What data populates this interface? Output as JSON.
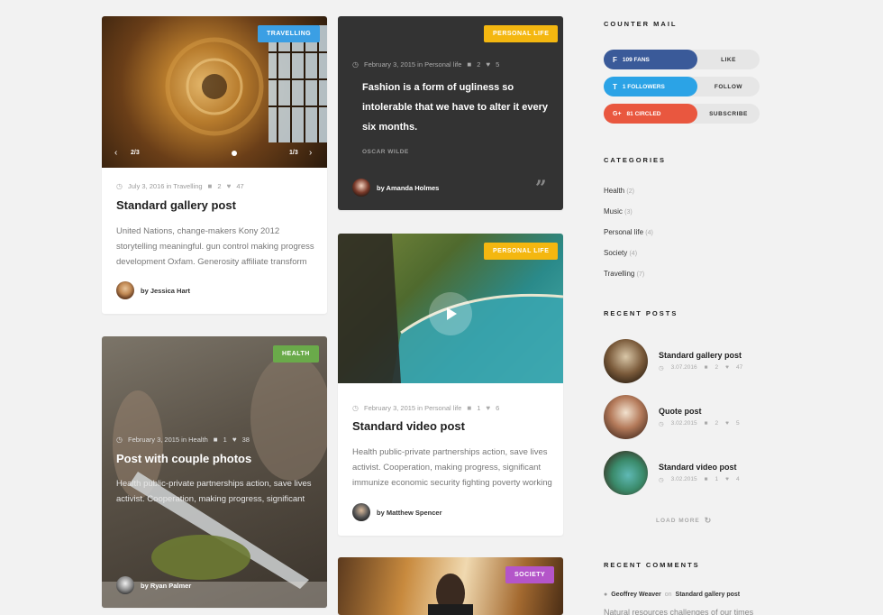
{
  "posts": {
    "gallery": {
      "badge": "TRAVELLING",
      "badge_color": "#3b9fe4",
      "slider_left": "2/3",
      "slider_right": "1/3",
      "date": "July 3, 2016 in Travelling",
      "comments": "2",
      "likes": "47",
      "title": "Standard gallery post",
      "excerpt": "United Nations, change-makers Kony 2012 storytelling meaningful. gun control making progress development Oxfam. Generosity affiliate transform",
      "author": "by Jessica Hart"
    },
    "quote": {
      "badge": "PERSONAL LIFE",
      "badge_color": "#f4b710",
      "date": "February 3, 2015 in Personal life",
      "comments": "2",
      "likes": "5",
      "quote": "Fashion is a form of ugliness so intolerable that we have to alter it every six months.",
      "quote_author": "OSCAR WILDE",
      "author": "by Amanda Holmes"
    },
    "photos": {
      "badge": "HEALTH",
      "badge_color": "#6aaa4a",
      "date": "February 3, 2015 in Health",
      "comments": "1",
      "likes": "38",
      "title": "Post with couple photos",
      "excerpt": "Health public-private partnerships action, save lives activist. Cooperation, making progress, significant",
      "author": "by Ryan Palmer"
    },
    "video": {
      "badge": "PERSONAL LIFE",
      "badge_color": "#f4b710",
      "date": "February 3, 2015 in Personal life",
      "comments": "1",
      "likes": "6",
      "title": "Standard video post",
      "excerpt": "Health public-private partnerships action, save lives activist. Cooperation, making progress, significant immunize economic security fighting poverty working",
      "author": "by Matthew Spencer"
    },
    "society": {
      "badge": "SOCIETY",
      "badge_color": "#b455c9"
    }
  },
  "sidebar": {
    "counter_title": "COUNTER MAIL",
    "social": [
      {
        "count": "109 FANS",
        "action": "LIKE",
        "color": "#3a5a99",
        "icon": "f"
      },
      {
        "count": "1 FOLLOWERS",
        "action": "FOLLOW",
        "color": "#2ba3e6",
        "icon": "t"
      },
      {
        "count": "81 CIRCLED",
        "action": "SUBSCRIBE",
        "color": "#e9573f",
        "icon": "G+"
      }
    ],
    "categories_title": "CATEGORIES",
    "categories": [
      {
        "name": "Health",
        "count": "(2)"
      },
      {
        "name": "Music",
        "count": "(3)"
      },
      {
        "name": "Personal life",
        "count": "(4)"
      },
      {
        "name": "Society",
        "count": "(4)"
      },
      {
        "name": "Travelling",
        "count": "(7)"
      }
    ],
    "recent_title": "RECENT POSTS",
    "recent": [
      {
        "title": "Standard gallery post",
        "date": "3.07.2016",
        "comments": "2",
        "likes": "47"
      },
      {
        "title": "Quote post",
        "date": "3.02.2015",
        "comments": "2",
        "likes": "5"
      },
      {
        "title": "Standard video post",
        "date": "3.02.2015",
        "comments": "1",
        "likes": "4"
      }
    ],
    "load_more": "LOAD MORE",
    "comments_title": "RECENT COMMENTS",
    "comment_author": "Geoffrey Weaver",
    "comment_on": "on",
    "comment_post": "Standard gallery post",
    "comment_text": "Natural resources challenges of our times"
  }
}
